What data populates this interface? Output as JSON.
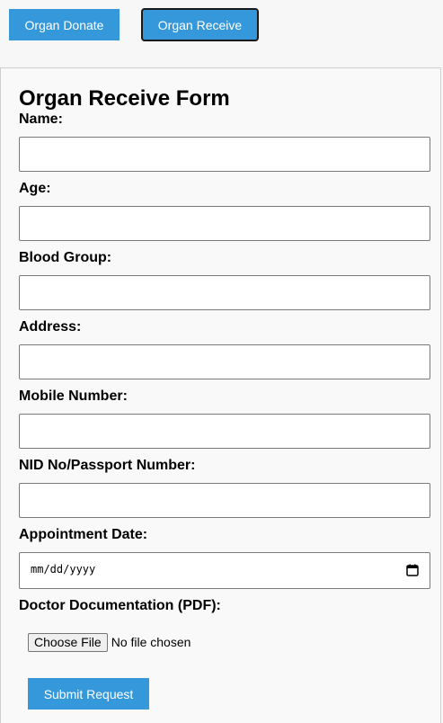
{
  "tabs": {
    "donate_label": "Organ Donate",
    "receive_label": "Organ Receive"
  },
  "form": {
    "title": "Organ Receive Form",
    "fields": {
      "name_label": "Name:",
      "age_label": "Age:",
      "blood_group_label": "Blood Group:",
      "address_label": "Address:",
      "mobile_label": "Mobile Number:",
      "nid_label": "NID No/Passport Number:",
      "appointment_label": "Appointment Date:",
      "doc_label": "Doctor Documentation (PDF):"
    },
    "date_placeholder": "mm/dd/yyyy",
    "file": {
      "button_label": "Choose File",
      "status": "No file chosen"
    },
    "submit_label": "Submit Request"
  },
  "colors": {
    "accent": "#3498db",
    "active_tab_border": "#1a1a1a"
  }
}
